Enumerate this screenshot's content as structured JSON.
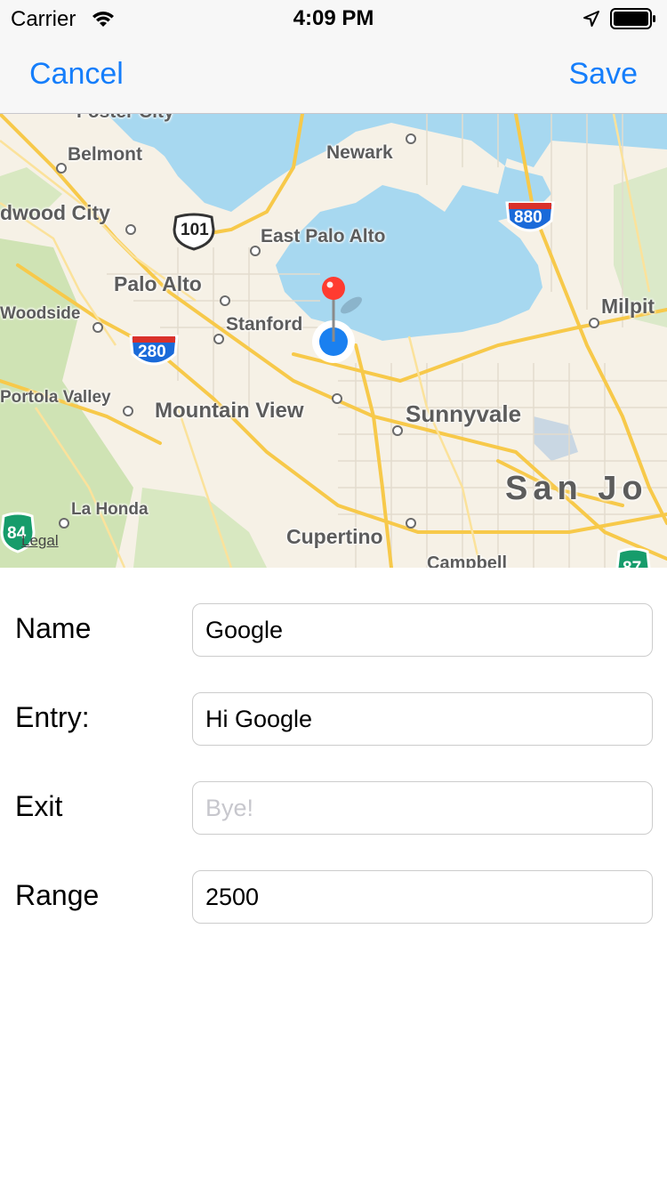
{
  "status_bar": {
    "carrier": "Carrier",
    "time": "4:09 PM",
    "icons": [
      "wifi-icon",
      "location-arrow-icon",
      "battery-icon"
    ]
  },
  "nav": {
    "cancel_label": "Cancel",
    "save_label": "Save"
  },
  "map": {
    "places": {
      "foster_city": "Foster City",
      "belmont": "Belmont",
      "newark": "Newark",
      "redwood_city": "dwood City",
      "east_palo_alto": "East Palo Alto",
      "palo_alto": "Palo Alto",
      "woodside": "Woodside",
      "stanford": "Stanford",
      "milpitas": "Milpit",
      "portola_valley": "Portola Valley",
      "mountain_view": "Mountain View",
      "sunnyvale": "Sunnyvale",
      "san_jose": "San Jo",
      "la_honda": "La Honda",
      "cupertino": "Cupertino",
      "campbell": "Campbell"
    },
    "shields": {
      "i880": "880",
      "us101": "101",
      "i280": "280",
      "sr84": "84",
      "sr87": "87"
    },
    "legal": "Legal",
    "colors": {
      "water": "#a7d8f0",
      "land": "#f6f1e6",
      "park": "#cfe3b4",
      "road": "#f7c94a",
      "user_dot": "#1a80f0",
      "pin": "#ff3b30"
    }
  },
  "form": {
    "name_label": "Name",
    "name_value": "Google",
    "entry_label": "Entry:",
    "entry_value": "Hi Google",
    "exit_label": "Exit",
    "exit_value": "",
    "exit_placeholder": "Bye!",
    "range_label": "Range",
    "range_value": "2500"
  },
  "accent_color": "#157efb"
}
